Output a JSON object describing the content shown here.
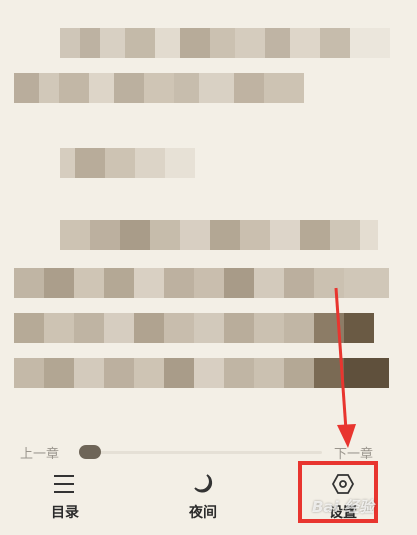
{
  "chapter_nav": {
    "prev_label": "上一章",
    "next_label": "下一章",
    "progress_fraction": 0.02
  },
  "toolbar": {
    "catalog": {
      "label": "目录",
      "icon": "list-icon"
    },
    "night": {
      "label": "夜间",
      "icon": "moon-icon"
    },
    "settings": {
      "label": "设置",
      "icon": "settings-icon"
    }
  },
  "annotation": {
    "highlight_color": "#e8352f",
    "watermark": "Bai 经验"
  },
  "colors": {
    "background": "#f3efe6",
    "thumb": "#6e6558",
    "text_dark": "#2b2b2b",
    "text_muted": "#9a958d"
  }
}
